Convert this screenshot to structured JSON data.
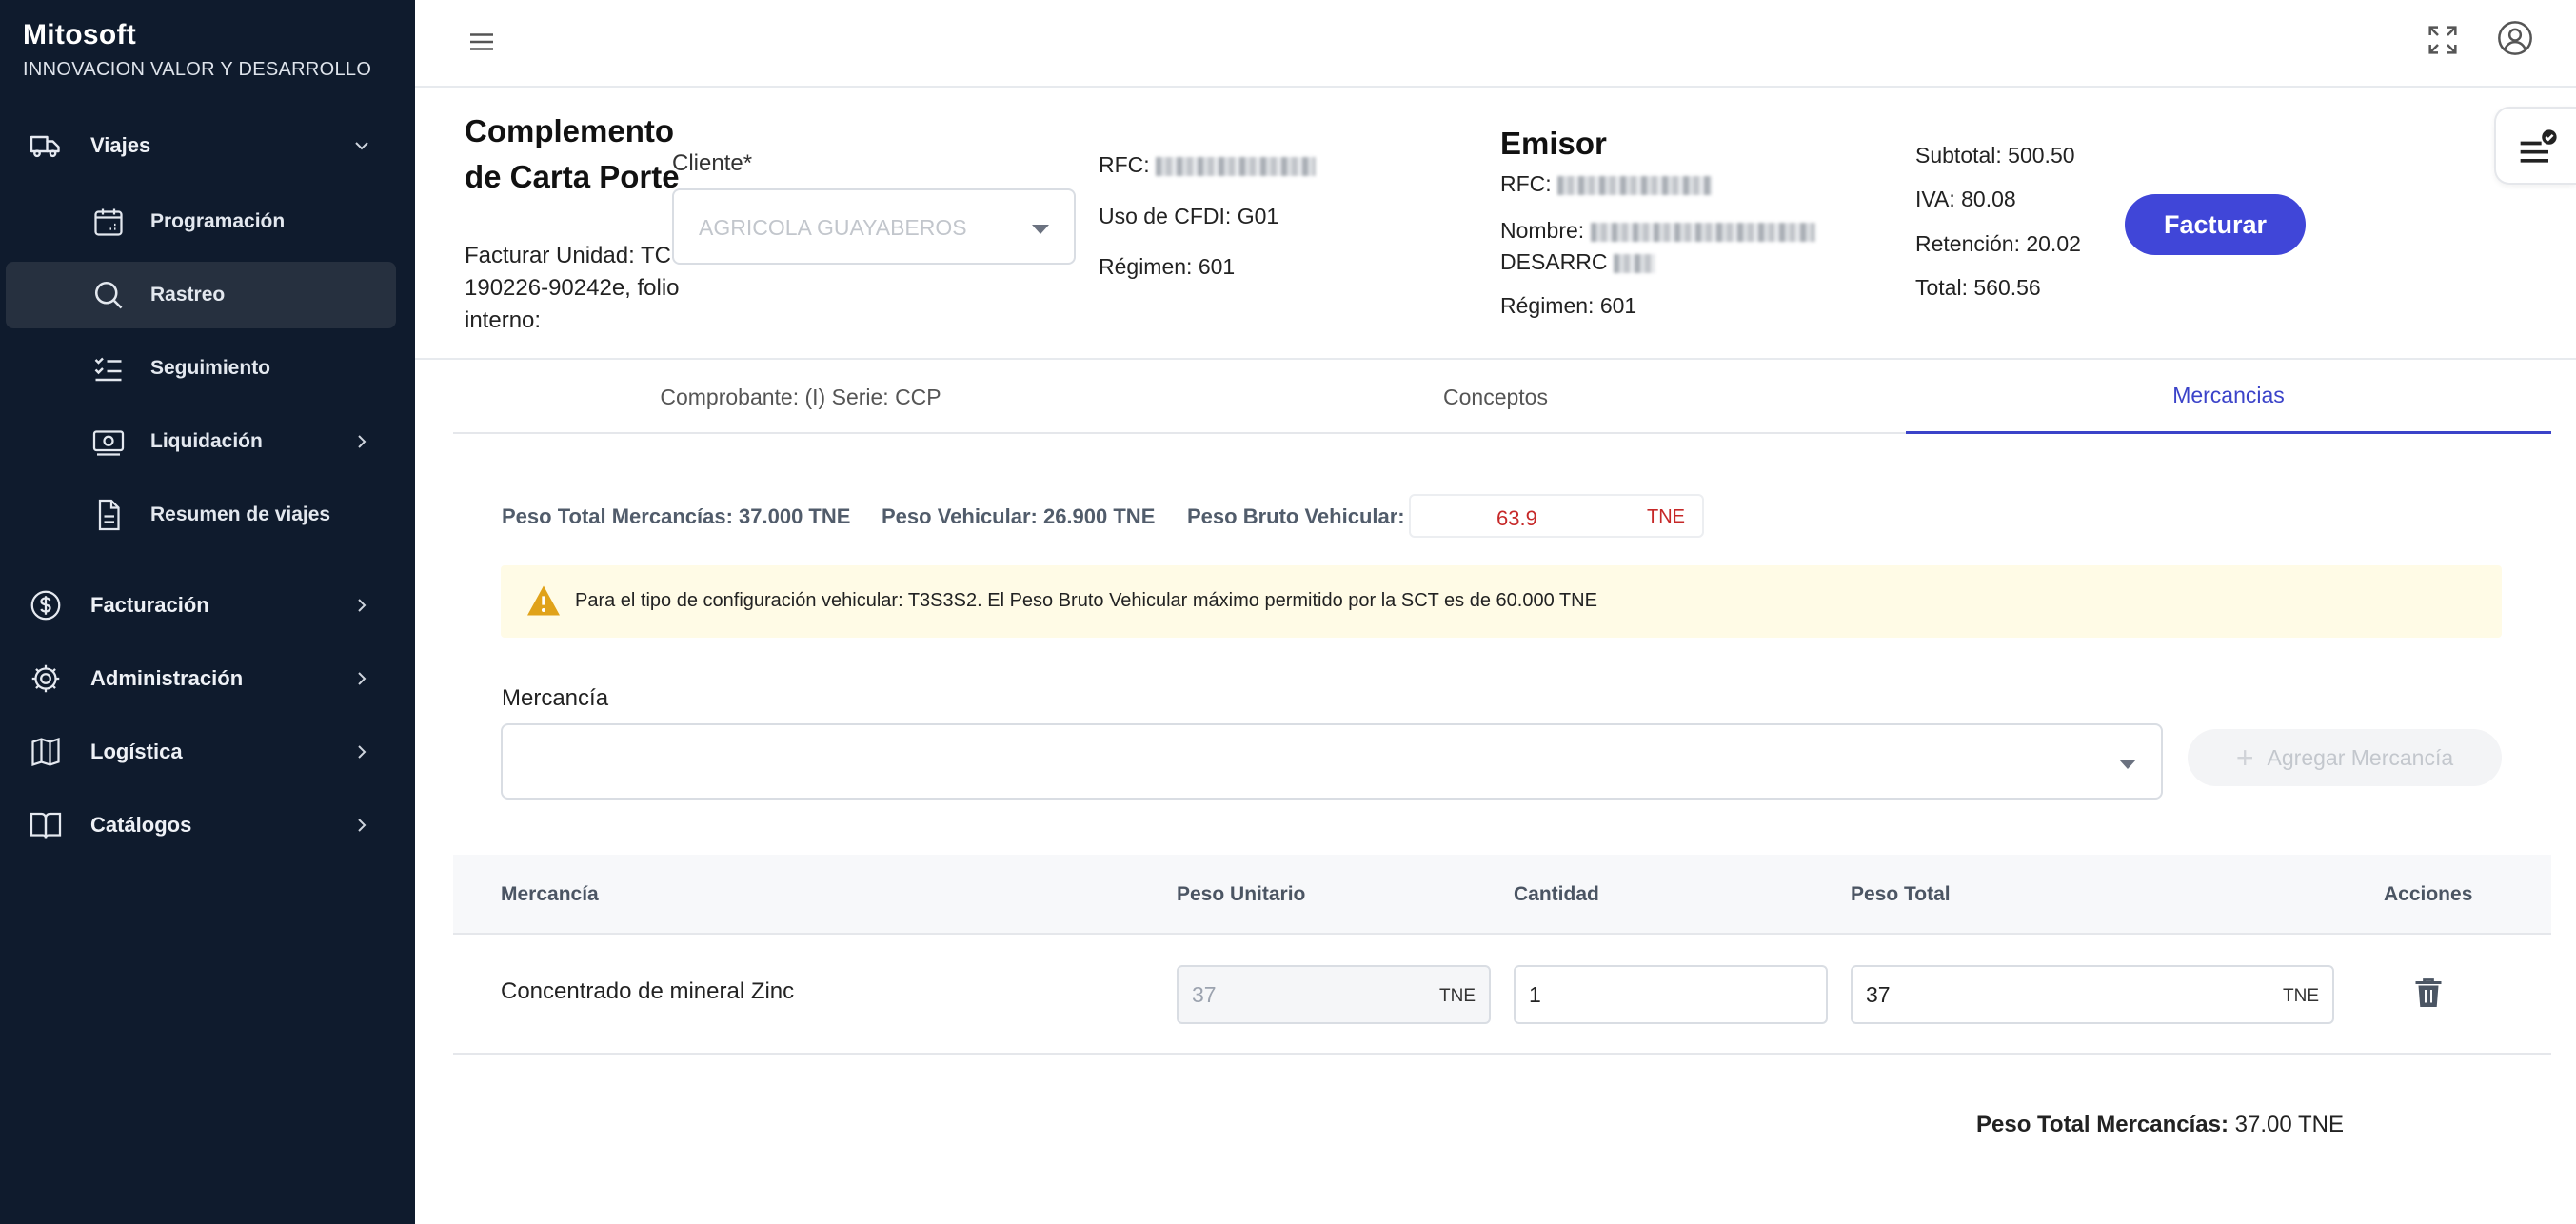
{
  "brand": {
    "name": "Mitosoft",
    "subtitle": "INNOVACION VALOR Y DESARROLLO"
  },
  "sidebar": {
    "items": [
      {
        "label": "Viajes",
        "icon": "truck-icon",
        "expanded": true
      },
      {
        "label": "Facturación",
        "icon": "dollar-icon"
      },
      {
        "label": "Administración",
        "icon": "gear-icon"
      },
      {
        "label": "Logística",
        "icon": "map-icon"
      },
      {
        "label": "Catálogos",
        "icon": "book-icon"
      }
    ],
    "viajes_sub": [
      {
        "label": "Programación",
        "icon": "calendar-icon"
      },
      {
        "label": "Rastreo",
        "icon": "search-icon",
        "active": true
      },
      {
        "label": "Seguimiento",
        "icon": "checklist-icon"
      },
      {
        "label": "Liquidación",
        "icon": "cash-icon"
      },
      {
        "label": "Resumen de viajes",
        "icon": "document-icon"
      }
    ]
  },
  "header": {
    "title": "Complemento de Carta Porte",
    "facturar_unidad": "Facturar Unidad: TC-190226-90242e, folio interno:",
    "cliente_label": "Cliente*",
    "cliente_value": "AGRICOLA GUAYABEROS",
    "rfc_label": "RFC:",
    "uso_cfdi": "Uso de CFDI: G01",
    "regimen": "Régimen: 601",
    "emisor_title": "Emisor",
    "emisor_rfc_label": "RFC:",
    "emisor_nombre_label": "Nombre:",
    "emisor_nombre_tail": "DESARRC",
    "emisor_regimen": "Régimen: 601",
    "subtotal": "Subtotal: 500.50",
    "iva": "IVA: 80.08",
    "retencion": "Retención: 20.02",
    "total": "Total: 560.56",
    "facturar_button": "Facturar"
  },
  "tabs": [
    {
      "label": "Comprobante: (I) Serie: CCP"
    },
    {
      "label": "Conceptos"
    },
    {
      "label": "Mercancias",
      "active": true
    }
  ],
  "weights": {
    "total_mercancias": "Peso Total Mercancías: 37.000 TNE",
    "vehicular": "Peso Vehicular: 26.900 TNE",
    "bruto_label": "Peso Bruto Vehicular:",
    "bruto_value": "63.9",
    "bruto_unit": "TNE"
  },
  "warning": "Para el tipo de configuración vehicular: T3S3S2. El Peso Bruto Vehicular máximo permitido por la SCT es de 60.000 TNE",
  "mercancia_label": "Mercancía",
  "agregar_button": "Agregar Mercancía",
  "table": {
    "headers": [
      "Mercancía",
      "Peso Unitario",
      "Cantidad",
      "Peso Total",
      "Acciones"
    ],
    "rows": [
      {
        "mercancia": "Concentrado de mineral Zinc",
        "peso_unitario": "37",
        "unidad": "TNE",
        "cantidad": "1",
        "peso_total": "37",
        "unidad_total": "TNE"
      }
    ]
  },
  "footer": {
    "label": "Peso Total Mercancías:",
    "value": "37.00 TNE"
  },
  "colors": {
    "sidebar": "#0f1b2d",
    "accent": "#4046d8",
    "warning_bg": "#fffbe6",
    "danger": "#c62828"
  }
}
